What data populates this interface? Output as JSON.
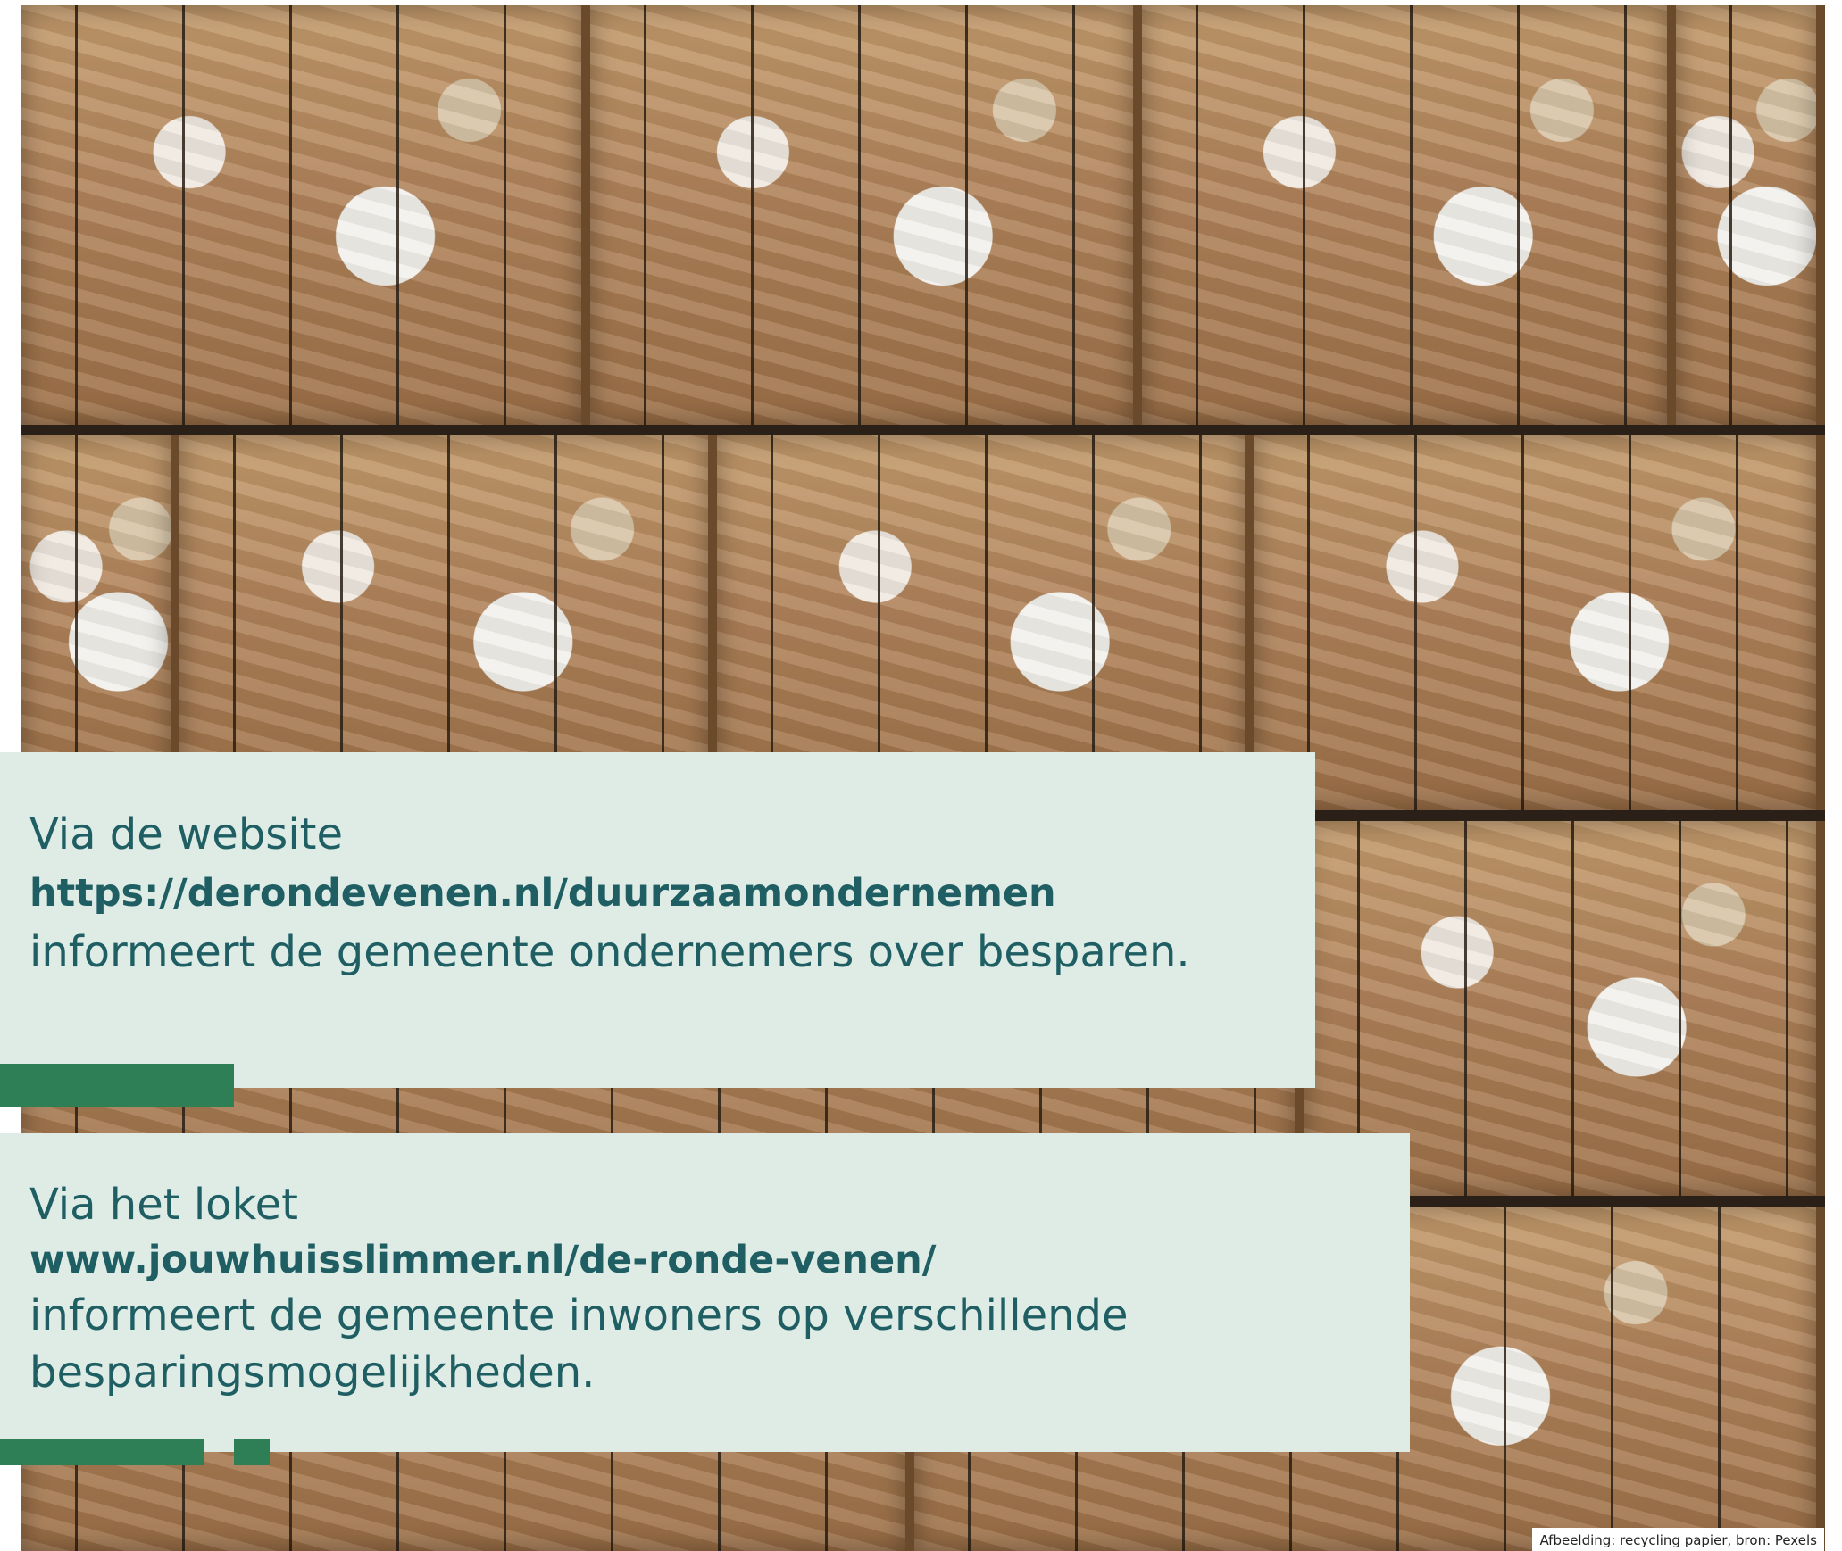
{
  "background_image": {
    "subject": "baled cardboard and paper for recycling",
    "caption": "Afbeelding: recycling papier, bron: Pexels"
  },
  "website_block": {
    "heading": "Via de website",
    "url": "https://derondevenen.nl/duurzaamondernemen",
    "description": "informeert de gemeente ondernemers over besparen."
  },
  "loket_block": {
    "heading": "Via het loket",
    "url": "www.jouwhuisslimmer.nl/de-ronde-venen/",
    "description_line1": "informeert de gemeente inwoners op verschillende",
    "description_line2": "besparingsmogelijkheden."
  },
  "colors": {
    "panel_background": "#dfece6",
    "text": "#1f5f63",
    "accent_bar": "#2e7f56"
  }
}
